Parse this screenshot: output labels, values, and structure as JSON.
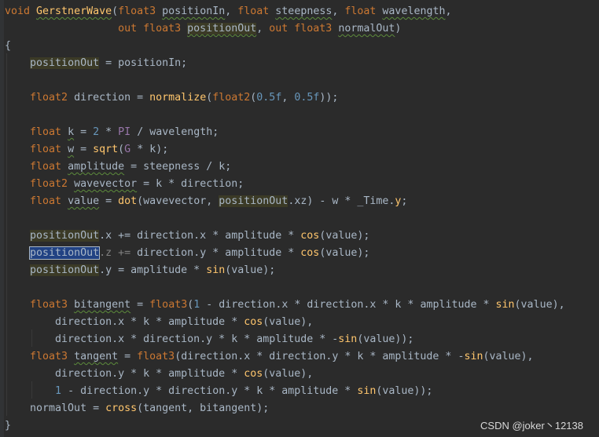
{
  "editor": {
    "lines": [
      "void GerstnerWave(float3 positionIn, float steepness, float wavelength,",
      "                  out float3 positionOut, out float3 normalOut)",
      "{",
      "    positionOut = positionIn;",
      "",
      "    float2 direction = normalize(float2(0.5f, 0.5f));",
      "",
      "    float k = 2 * PI / wavelength;",
      "    float w = sqrt(G * k);",
      "    float amplitude = steepness / k;",
      "    float2 wavevector = k * direction;",
      "    float value = dot(wavevector, positionOut.xz) - w * _Time.y;",
      "",
      "    positionOut.x += direction.x * amplitude * cos(value);",
      "    positionOut.z += direction.y * amplitude * cos(value);",
      "    positionOut.y = amplitude * sin(value);",
      "",
      "    float3 bitangent = float3(1 - direction.x * direction.x * k * amplitude * sin(value),",
      "        direction.x * k * amplitude * cos(value),",
      "        direction.x * direction.y * k * amplitude * -sin(value));",
      "    float3 tangent = float3(direction.x * direction.y * k * amplitude * -sin(value),",
      "        direction.y * k * amplitude * cos(value),",
      "        1 - direction.y * direction.y * k * amplitude * sin(value));",
      "    normalOut = cross(tangent, bitangent);",
      "}"
    ]
  },
  "watermark": "CSDN @joker丶12138",
  "colors": {
    "background": "#2b2b2b",
    "keyword": "#cc7832",
    "function": "#ffc66d",
    "number": "#6897bb",
    "constant": "#9876aa",
    "text": "#a9b7c6",
    "highlight": "#3b3a26"
  }
}
